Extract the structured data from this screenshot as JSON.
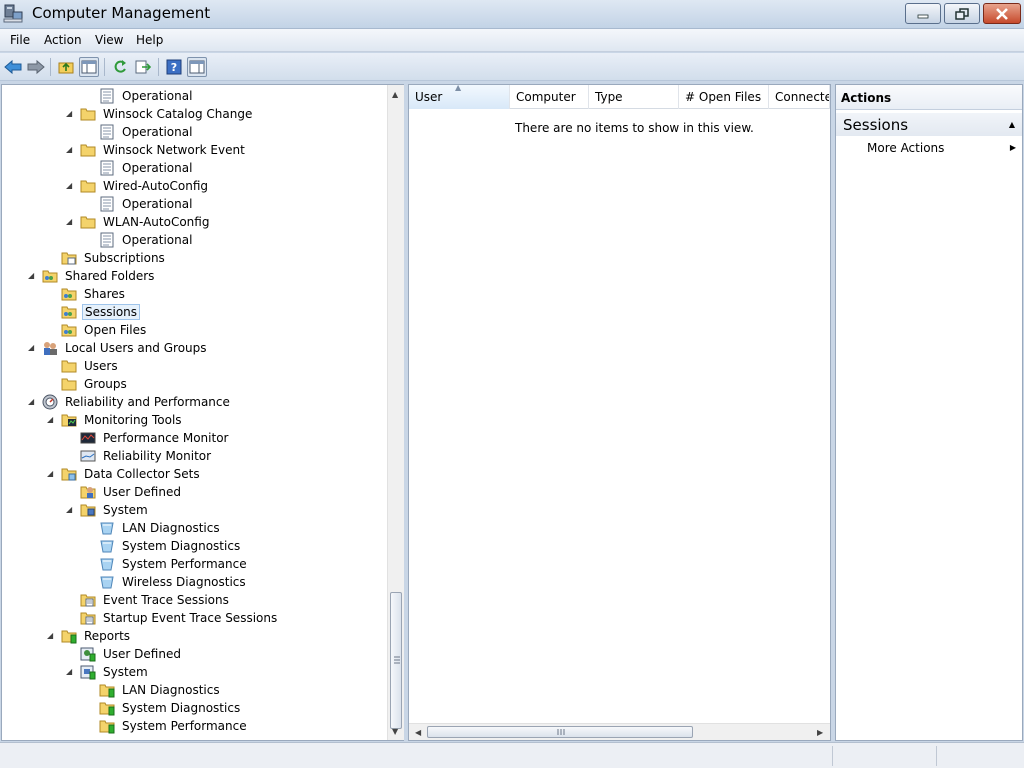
{
  "window": {
    "title": "Computer Management"
  },
  "menu": [
    "File",
    "Action",
    "View",
    "Help"
  ],
  "tree": [
    {
      "label": "Operational",
      "icon": "log-icon",
      "indent": 4,
      "expander": "none"
    },
    {
      "label": "Winsock Catalog Change",
      "icon": "folder-icon",
      "indent": 3,
      "expander": "expanded"
    },
    {
      "label": "Operational",
      "icon": "log-icon",
      "indent": 4,
      "expander": "none"
    },
    {
      "label": "Winsock Network Event",
      "icon": "folder-icon",
      "indent": 3,
      "expander": "expanded"
    },
    {
      "label": "Operational",
      "icon": "log-icon",
      "indent": 4,
      "expander": "none"
    },
    {
      "label": "Wired-AutoConfig",
      "icon": "folder-icon",
      "indent": 3,
      "expander": "expanded"
    },
    {
      "label": "Operational",
      "icon": "log-icon",
      "indent": 4,
      "expander": "none"
    },
    {
      "label": "WLAN-AutoConfig",
      "icon": "folder-icon",
      "indent": 3,
      "expander": "expanded"
    },
    {
      "label": "Operational",
      "icon": "log-icon",
      "indent": 4,
      "expander": "none"
    },
    {
      "label": "Subscriptions",
      "icon": "subscriptions-icon",
      "indent": 2,
      "expander": "none"
    },
    {
      "label": "Shared Folders",
      "icon": "shared-folders-icon",
      "indent": 1,
      "expander": "expanded"
    },
    {
      "label": "Shares",
      "icon": "shared-folders-icon",
      "indent": 2,
      "expander": "none"
    },
    {
      "label": "Sessions",
      "icon": "shared-folders-icon",
      "indent": 2,
      "expander": "none",
      "selected": true
    },
    {
      "label": "Open Files",
      "icon": "shared-folders-icon",
      "indent": 2,
      "expander": "none"
    },
    {
      "label": "Local Users and Groups",
      "icon": "users-groups-icon",
      "indent": 1,
      "expander": "expanded"
    },
    {
      "label": "Users",
      "icon": "folder-icon",
      "indent": 2,
      "expander": "none"
    },
    {
      "label": "Groups",
      "icon": "folder-icon",
      "indent": 2,
      "expander": "none"
    },
    {
      "label": "Reliability and Performance",
      "icon": "performance-icon",
      "indent": 1,
      "expander": "expanded"
    },
    {
      "label": "Monitoring Tools",
      "icon": "monitoring-folder-icon",
      "indent": 2,
      "expander": "expanded"
    },
    {
      "label": "Performance Monitor",
      "icon": "performance-monitor-icon",
      "indent": 3,
      "expander": "none"
    },
    {
      "label": "Reliability Monitor",
      "icon": "reliability-monitor-icon",
      "indent": 3,
      "expander": "none"
    },
    {
      "label": "Data Collector Sets",
      "icon": "data-collector-folder-icon",
      "indent": 2,
      "expander": "expanded"
    },
    {
      "label": "User Defined",
      "icon": "user-defined-icon",
      "indent": 3,
      "expander": "none"
    },
    {
      "label": "System",
      "icon": "system-folder-icon",
      "indent": 3,
      "expander": "expanded"
    },
    {
      "label": "LAN Diagnostics",
      "icon": "collector-set-icon",
      "indent": 4,
      "expander": "none"
    },
    {
      "label": "System Diagnostics",
      "icon": "collector-set-icon",
      "indent": 4,
      "expander": "none"
    },
    {
      "label": "System Performance",
      "icon": "collector-set-icon",
      "indent": 4,
      "expander": "none"
    },
    {
      "label": "Wireless Diagnostics",
      "icon": "collector-set-icon",
      "indent": 4,
      "expander": "none"
    },
    {
      "label": "Event Trace Sessions",
      "icon": "trace-folder-icon",
      "indent": 3,
      "expander": "none"
    },
    {
      "label": "Startup Event Trace Sessions",
      "icon": "trace-folder-icon",
      "indent": 3,
      "expander": "none"
    },
    {
      "label": "Reports",
      "icon": "reports-folder-icon",
      "indent": 2,
      "expander": "expanded"
    },
    {
      "label": "User Defined",
      "icon": "report-user-icon",
      "indent": 3,
      "expander": "none"
    },
    {
      "label": "System",
      "icon": "report-system-icon",
      "indent": 3,
      "expander": "expanded"
    },
    {
      "label": "LAN Diagnostics",
      "icon": "reports-folder-icon",
      "indent": 4,
      "expander": "none"
    },
    {
      "label": "System Diagnostics",
      "icon": "reports-folder-icon",
      "indent": 4,
      "expander": "none"
    },
    {
      "label": "System Performance",
      "icon": "reports-folder-icon",
      "indent": 4,
      "expander": "none"
    }
  ],
  "list": {
    "columns": [
      "User",
      "Computer",
      "Type",
      "# Open Files",
      "Connected"
    ],
    "sorted_column": "User",
    "empty_message": "There are no items to show in this view."
  },
  "actions": {
    "header": "Actions",
    "section": "Sessions",
    "items": [
      "More Actions"
    ]
  }
}
